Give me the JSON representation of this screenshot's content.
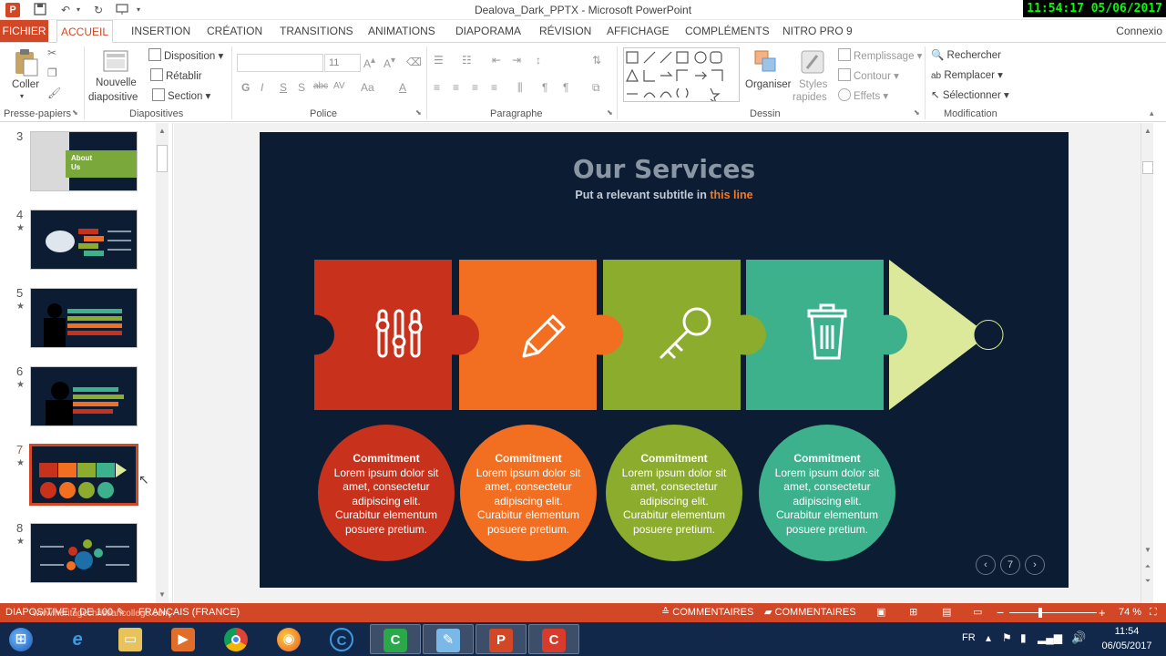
{
  "window": {
    "title": "Dealova_Dark_PPTX - Microsoft PowerPoint",
    "app_icon": "P",
    "clock_overlay": "11:54:17  05/06/2017"
  },
  "quick_access": {
    "save_icon": "save-icon",
    "undo_icon": "undo-icon",
    "redo_icon": "repeat-icon",
    "customize_icon": "presentation-icon"
  },
  "tabs": [
    {
      "label": "FICHIER"
    },
    {
      "label": "ACCUEIL"
    },
    {
      "label": "INSERTION"
    },
    {
      "label": "CRÉATION"
    },
    {
      "label": "TRANSITIONS"
    },
    {
      "label": "ANIMATIONS"
    },
    {
      "label": "DIAPORAMA"
    },
    {
      "label": "RÉVISION"
    },
    {
      "label": "AFFICHAGE"
    },
    {
      "label": "COMPLÉMENTS"
    },
    {
      "label": "NITRO PRO 9"
    }
  ],
  "account": "Connexio",
  "ribbon": {
    "clipboard": {
      "paste": "Coller",
      "group": "Presse-papiers"
    },
    "slides": {
      "new_slide_line1": "Nouvelle",
      "new_slide_line2": "diapositive",
      "layout": "Disposition",
      "reset": "Rétablir",
      "section": "Section",
      "group": "Diapositives"
    },
    "font": {
      "size": "11",
      "group": "Police",
      "bold": "G",
      "italic": "I",
      "underline": "S",
      "shadow": "S",
      "strike": "abc",
      "spacing": "AV",
      "case": "Aa",
      "color": "A"
    },
    "paragraph": {
      "group": "Paragraphe"
    },
    "drawing": {
      "arrange": "Organiser",
      "quick_styles_line1": "Styles",
      "quick_styles_line2": "rapides",
      "fill": "Remplissage",
      "outline": "Contour",
      "effects": "Effets",
      "group": "Dessin"
    },
    "editing": {
      "find": "Rechercher",
      "replace": "Remplacer",
      "select": "Sélectionner",
      "group": "Modification"
    }
  },
  "thumbnails": [
    {
      "number": "3",
      "star": ""
    },
    {
      "number": "4",
      "star": "★"
    },
    {
      "number": "5",
      "star": "★"
    },
    {
      "number": "6",
      "star": "★"
    },
    {
      "number": "7",
      "star": "★"
    },
    {
      "number": "8",
      "star": "★"
    }
  ],
  "thumb3_text": "About Us",
  "slide": {
    "title": "Our Services",
    "subtitle_pre": "Put a relevant subtitle in ",
    "subtitle_highlight": "this line",
    "puzzle_colors": [
      "#c8321d",
      "#f26f21",
      "#8cac2e",
      "#3cb18c",
      "#dce99a"
    ],
    "puzzle_icons": [
      "sliders-icon",
      "pencil-icon",
      "key-icon",
      "trash-icon"
    ],
    "circles": [
      {
        "heading": "Commitment",
        "body": "Lorem ipsum dolor sit amet, consectetur adipiscing elit. Curabitur elementum posuere pretium.",
        "color": "#c8321d"
      },
      {
        "heading": "Commitment",
        "body": "Lorem ipsum dolor sit amet, consectetur adipiscing elit. Curabitur elementum posuere pretium.",
        "color": "#f26f21"
      },
      {
        "heading": "Commitment",
        "body": "Lorem ipsum dolor sit amet, consectetur adipiscing elit. Curabitur elementum posuere pretium.",
        "color": "#8cac2e"
      },
      {
        "heading": "Commitment",
        "body": "Lorem ipsum dolor sit amet, consectetur adipiscing elit. Curabitur elementum posuere pretium."
      }
    ],
    "page_number": "7",
    "background": "#0c1c33"
  },
  "status": {
    "slide_info": "DIAPOSITIVE 7 DE 100",
    "language": "FRANÇAIS (FRANCE)",
    "notes": "COMMENTAIRES",
    "comments": "COMMENTAIRES",
    "zoom": "74 %",
    "zoom_minus": "−",
    "zoom_plus": "+",
    "watermark": "www.heritagechristiancollege.com"
  },
  "taskbar": {
    "language": "FR",
    "time": "11:54",
    "date": "06/05/2017",
    "apps": [
      "windows-start-icon",
      "internet-explorer-icon",
      "file-explorer-icon",
      "media-player-icon",
      "chrome-icon",
      "firefox-icon",
      "camtasia-recorder-icon",
      "camtasia-icon",
      "notepad-icon",
      "powerpoint-icon",
      "camtasia-studio-icon"
    ]
  },
  "accent": "#d24726"
}
